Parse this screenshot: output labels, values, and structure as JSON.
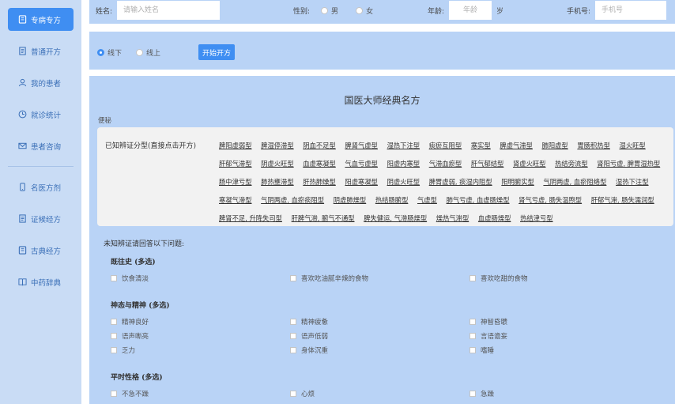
{
  "sidebar": {
    "items": [
      {
        "label": "专病专方",
        "icon": "book-icon",
        "active": true
      },
      {
        "label": "普通开方",
        "icon": "document-icon",
        "active": false
      },
      {
        "label": "我的患者",
        "icon": "user-icon",
        "active": false
      },
      {
        "label": "就诊统计",
        "icon": "clock-icon",
        "active": false
      },
      {
        "label": "患者咨询",
        "icon": "mail-icon",
        "active": false
      },
      {
        "label": "名医方剂",
        "icon": "phone-icon",
        "active": false
      },
      {
        "label": "证候经方",
        "icon": "document-icon",
        "active": false
      },
      {
        "label": "古典经方",
        "icon": "book-icon",
        "active": false
      },
      {
        "label": "中药辞典",
        "icon": "open-book-icon",
        "active": false
      }
    ]
  },
  "form": {
    "name_label": "姓名:",
    "name_placeholder": "请输入姓名",
    "gender_label": "性别:",
    "gender_male": "男",
    "gender_female": "女",
    "age_label": "年龄:",
    "age_placeholder": "年龄",
    "age_unit": "岁",
    "phone_label": "手机号:",
    "phone_placeholder": "手机号"
  },
  "mode": {
    "offline": "线下",
    "online": "线上",
    "button": "开始开方"
  },
  "body": {
    "title": "国医大师经典名方",
    "small_label": "便秘",
    "known_label": "已知辨证分型(直接点击开方)",
    "syndromes": [
      "脾阳虚弱型",
      "脾湿停滞型",
      "阴血不足型",
      "脾肾气虚型",
      "湿热下注型",
      "痰瘀互阻型",
      "寒实型",
      "脾虚气滞型",
      "肺阳虚型",
      "胃肠积热型",
      "湿火旺型",
      "肝郁气滞型",
      "阴虚火旺型",
      "血虚寒凝型",
      "气血亏虚型",
      "阳虚内寒型",
      "气滞血瘀型",
      "肝气郁结型",
      "肾虚火旺型",
      "热结旁流型",
      "肾阳亏虚, 脾胃湿热型",
      "肠中津亏型",
      "肺热壅滞型",
      "肝热肺燥型",
      "阳虚寒凝型",
      "阴虚火旺型",
      "脾胃虚弱, 痰湿内阻型",
      "阳明腑实型",
      "气阴两虚, 血瘀阻络型",
      "湿热下注型",
      "寒凝气滞型",
      "气阴两虚, 血瘀痰阻型",
      "阴虚肺燥型",
      "热结肠腑型",
      "气虚型",
      "肺气亏虚, 血虚肠燥型",
      "肾气亏虚, 肠失温煦型",
      "肝郁气滞, 肠失濡润型",
      "脾肾不足, 升降失司型",
      "肝脾气滞, 腑气不通型",
      "脾失健运, 气滞肠燥型",
      "燥热气滞型",
      "血虚肠燥型",
      "热结津亏型"
    ],
    "unknown_head": "未知辨证请回答以下问题:",
    "questions": [
      {
        "title": "既往史 (多选)",
        "options": [
          "饮食清淡",
          "喜欢吃油腻辛辣的食物",
          "喜欢吃甜的食物"
        ]
      },
      {
        "title": "神态与精神 (多选)",
        "options": [
          "精神良好",
          "精神疲惫",
          "神智昏聩",
          "语声嘶亮",
          "语声低弱",
          "言语谵妄",
          "乏力",
          "身体沉重",
          "嗜睡"
        ]
      },
      {
        "title": "平时性格 (多选)",
        "options": [
          "不急不躁",
          "心烦",
          "急躁"
        ]
      }
    ]
  },
  "colors": {
    "accent": "#3f8ef2",
    "sidebar_bg": "#c9dcf5",
    "panel_bg": "#b9d3f6",
    "box_bg": "#f2f2f2"
  }
}
